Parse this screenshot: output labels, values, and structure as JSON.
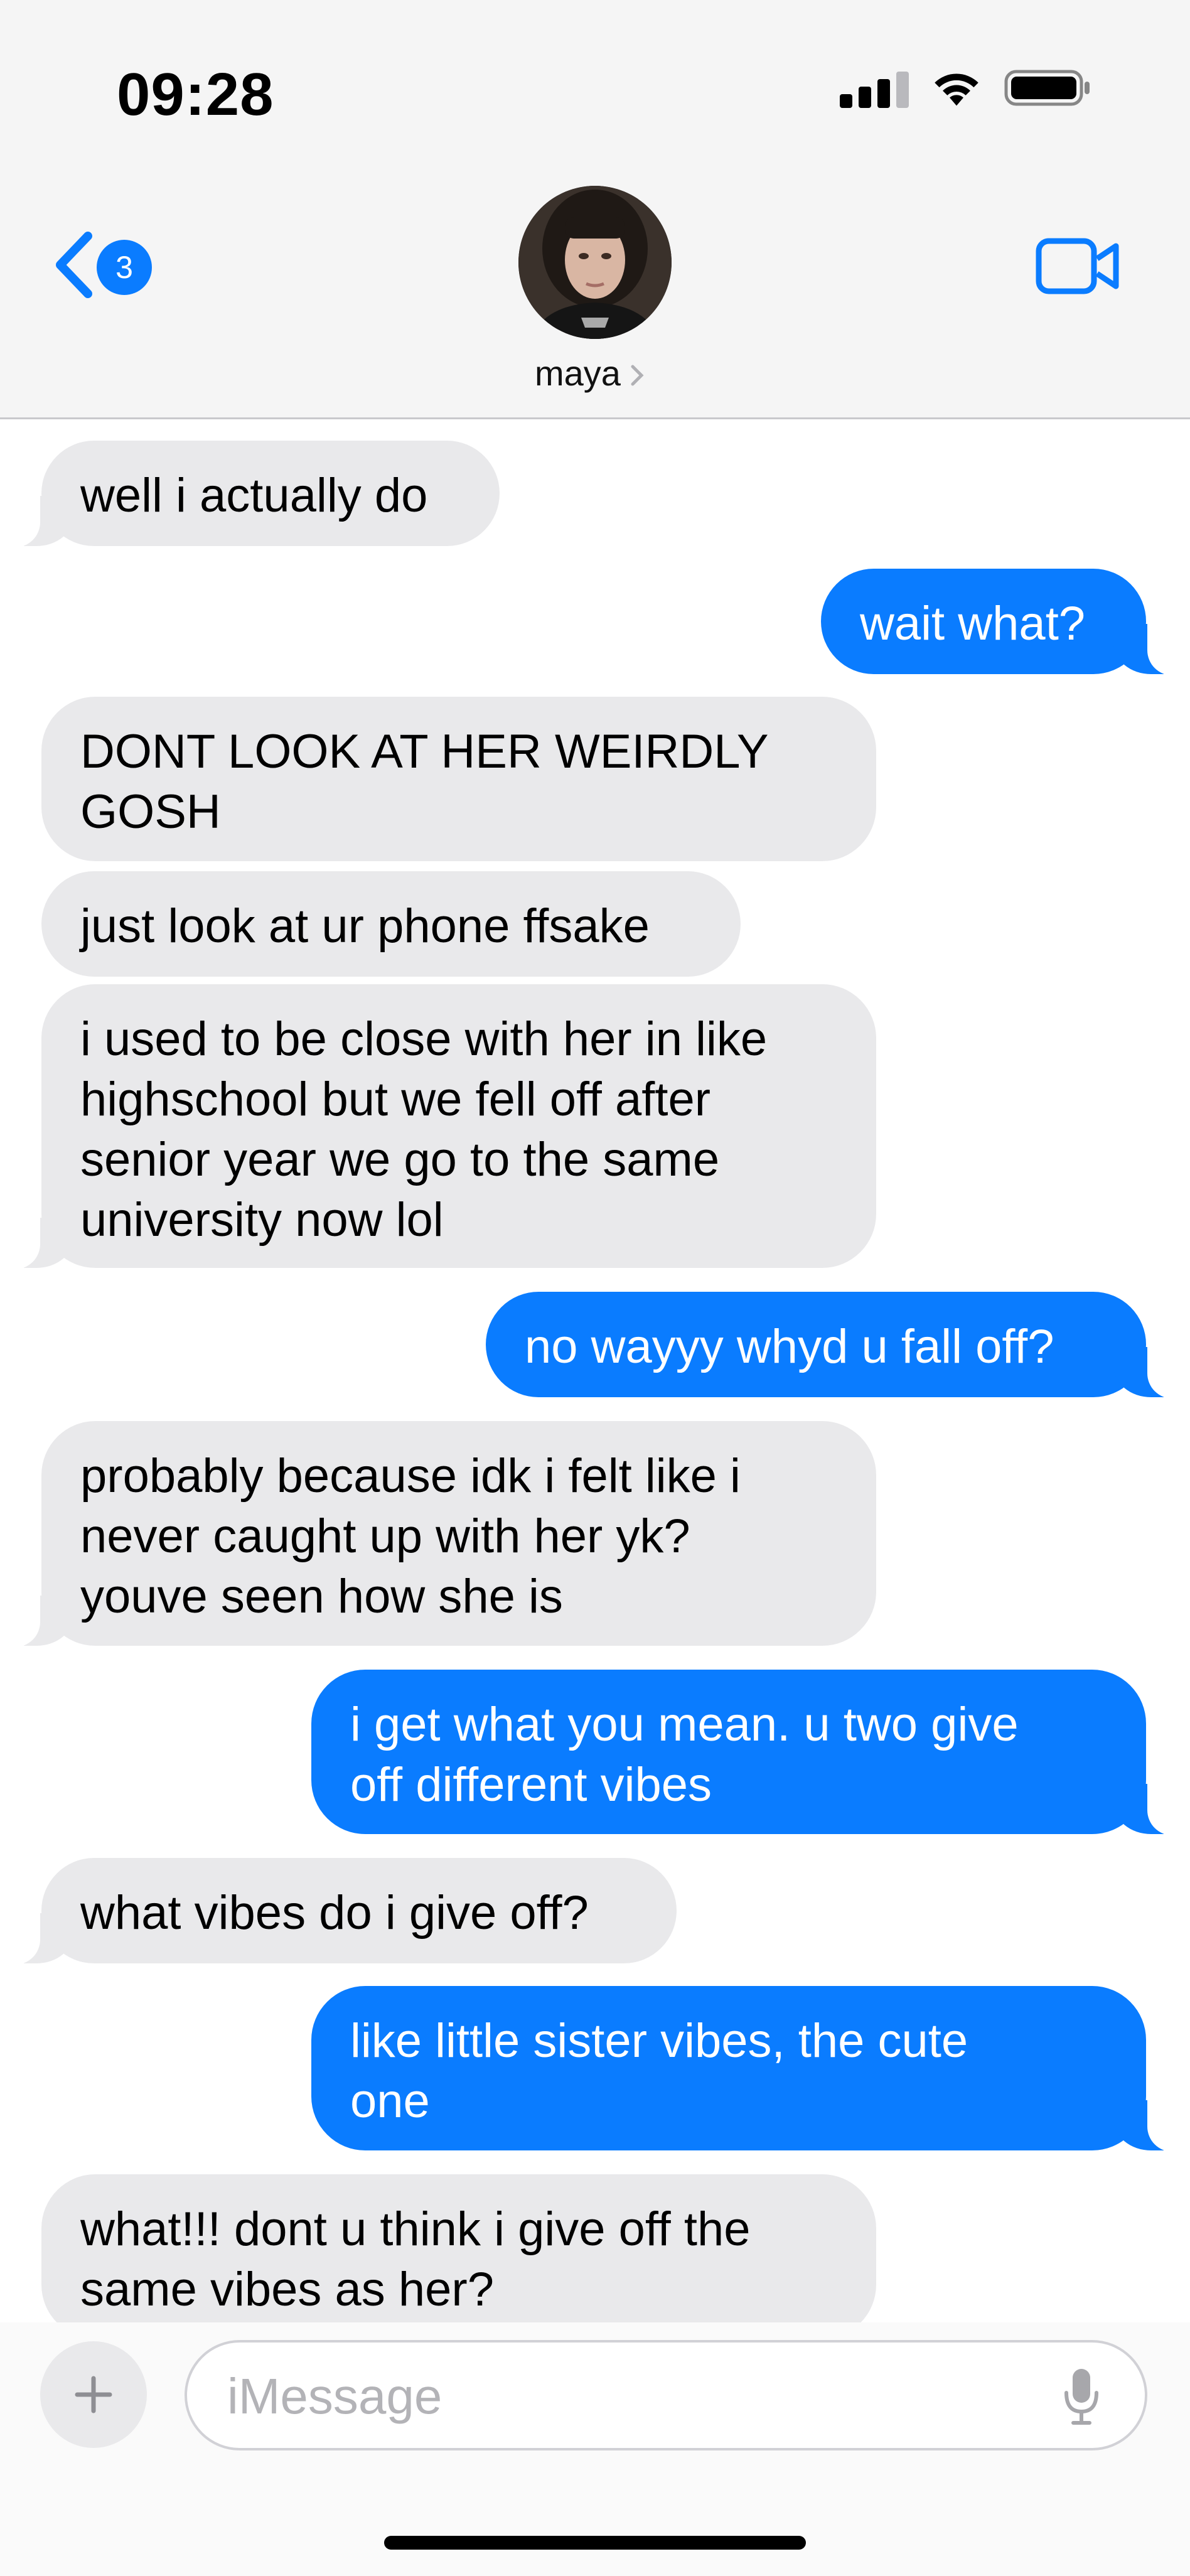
{
  "status_bar": {
    "time": "09:28"
  },
  "header": {
    "back_badge_count": "3",
    "contact_name": "maya",
    "accent_color": "#0a7cff"
  },
  "messages": [
    {
      "direction": "incoming",
      "text": "well i actually do"
    },
    {
      "direction": "outgoing",
      "text": "wait what?"
    },
    {
      "direction": "incoming",
      "text": "DONT LOOK AT HER WEIRDLY\nGOSH"
    },
    {
      "direction": "incoming",
      "text": "just look at ur phone ffsake"
    },
    {
      "direction": "incoming",
      "text": "i used to be close with her in like\nhighschool but we fell off after\nsenior year we go to the same\nuniversity now lol"
    },
    {
      "direction": "outgoing",
      "text": "no wayyy whyd u fall off?"
    },
    {
      "direction": "incoming",
      "text": "probably because idk i felt like i\nnever caught up with her yk?\nyouve seen how she is"
    },
    {
      "direction": "outgoing",
      "text": "i get what you mean. u two give\noff different vibes"
    },
    {
      "direction": "incoming",
      "text": "what vibes do i give off?"
    },
    {
      "direction": "outgoing",
      "text": "like little sister vibes, the cute\none"
    },
    {
      "direction": "incoming",
      "text": "what!!! dont u think i give off the\nsame vibes as her?"
    }
  ],
  "input_bar": {
    "placeholder": "iMessage"
  },
  "icons": {
    "back": "chevron-left-icon",
    "video": "video-camera-icon",
    "add": "plus-icon",
    "mic": "microphone-icon"
  }
}
